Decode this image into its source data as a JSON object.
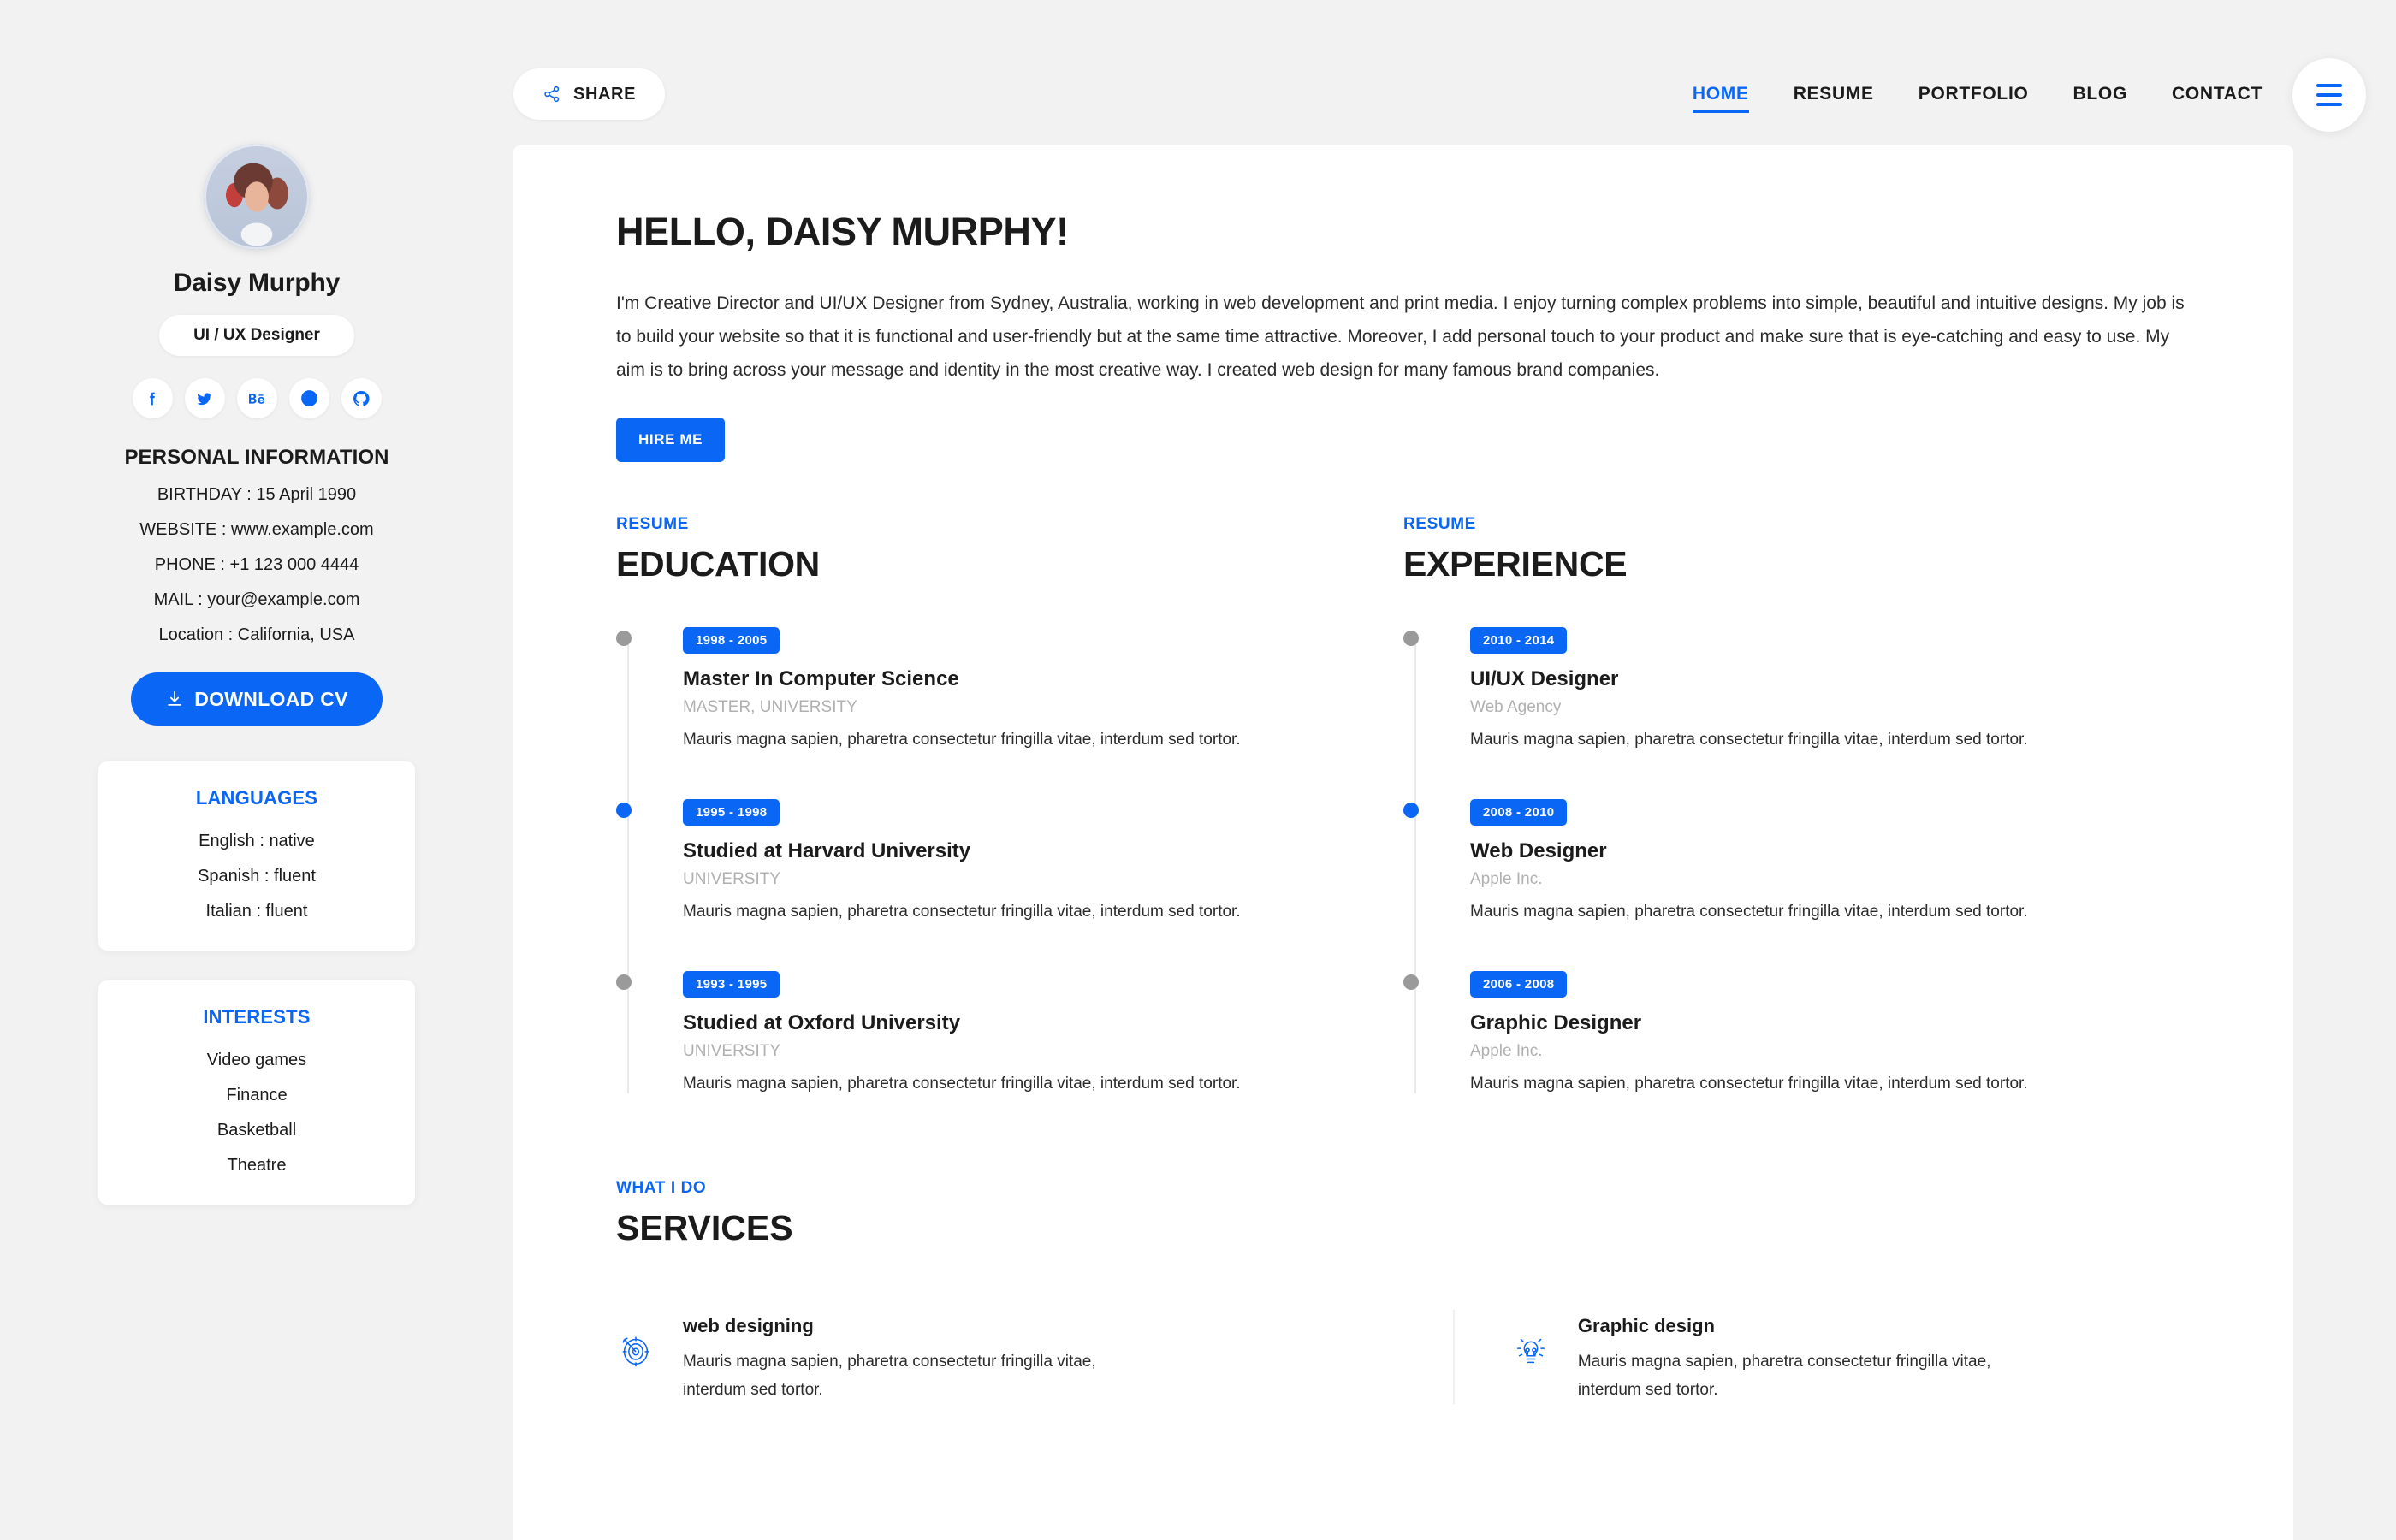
{
  "colors": {
    "accent": "#0a66f5",
    "page_bg": "#f2f2f2",
    "card_bg": "#ffffff",
    "muted": "#b0b0b0",
    "dot_gray": "#9a9a9a"
  },
  "sidebar": {
    "name": "Daisy Murphy",
    "role_pill": "UI / UX Designer",
    "social": [
      {
        "icon": "facebook-icon",
        "label": "Facebook"
      },
      {
        "icon": "twitter-icon",
        "label": "Twitter"
      },
      {
        "icon": "behance-icon",
        "label": "Behance"
      },
      {
        "icon": "dribbble-icon",
        "label": "Dribbble"
      },
      {
        "icon": "github-icon",
        "label": "GitHub"
      }
    ],
    "personal_title": "PERSONAL INFORMATION",
    "info": [
      "BIRTHDAY : 15 April 1990",
      "WEBSITE : www.example.com",
      "PHONE : +1 123 000 4444",
      "MAIL : your@example.com",
      "Location : California, USA"
    ],
    "download_label": "DOWNLOAD CV",
    "download_icon": "download-icon",
    "languages": {
      "title": "LANGUAGES",
      "rows": [
        "English : native",
        "Spanish : fluent",
        "Italian : fluent"
      ]
    },
    "interests": {
      "title": "INTERESTS",
      "rows": [
        "Video games",
        "Finance",
        "Basketball",
        "Theatre"
      ]
    }
  },
  "topbar": {
    "share_label": "SHARE",
    "share_icon": "share-network-icon",
    "menu_icon": "hamburger-menu-icon",
    "nav": [
      {
        "label": "HOME",
        "active": true
      },
      {
        "label": "RESUME",
        "active": false
      },
      {
        "label": "PORTFOLIO",
        "active": false
      },
      {
        "label": "BLOG",
        "active": false
      },
      {
        "label": "CONTACT",
        "active": false
      }
    ]
  },
  "hero": {
    "title": "HELLO, DAISY MURPHY!",
    "text": "I'm Creative Director and UI/UX Designer from Sydney, Australia, working in web development and print media. I enjoy turning complex problems into simple, beautiful and intuitive designs. My job is to build your website so that it is functional and user-friendly but at the same time attractive. Moreover, I add personal touch to your product and make sure that is eye-catching and easy to use. My aim is to bring across your message and identity in the most creative way. I created web design for many famous brand companies.",
    "cta_label": "HIRE ME"
  },
  "education": {
    "eyebrow": "RESUME",
    "title": "EDUCATION",
    "items": [
      {
        "period": "1998 - 2005",
        "role": "Master In Computer Science",
        "sub": "MASTER, UNIVERSITY",
        "desc": "Mauris magna sapien, pharetra consectetur fringilla vitae, interdum sed tortor.",
        "dot": "gray"
      },
      {
        "period": "1995 - 1998",
        "role": "Studied at Harvard University",
        "sub": "UNIVERSITY",
        "desc": "Mauris magna sapien, pharetra consectetur fringilla vitae, interdum sed tortor.",
        "dot": "accent"
      },
      {
        "period": "1993 - 1995",
        "role": "Studied at Oxford University",
        "sub": "UNIVERSITY",
        "desc": "Mauris magna sapien, pharetra consectetur fringilla vitae, interdum sed tortor.",
        "dot": "gray"
      }
    ]
  },
  "experience": {
    "eyebrow": "RESUME",
    "title": "EXPERIENCE",
    "items": [
      {
        "period": "2010 - 2014",
        "role": "UI/UX Designer",
        "sub": "Web Agency",
        "desc": "Mauris magna sapien, pharetra consectetur fringilla vitae, interdum sed tortor.",
        "dot": "gray"
      },
      {
        "period": "2008 - 2010",
        "role": "Web Designer",
        "sub": "Apple Inc.",
        "desc": "Mauris magna sapien, pharetra consectetur fringilla vitae, interdum sed tortor.",
        "dot": "accent"
      },
      {
        "period": "2006 - 2008",
        "role": "Graphic Designer",
        "sub": "Apple Inc.",
        "desc": "Mauris magna sapien, pharetra consectetur fringilla vitae, interdum sed tortor.",
        "dot": "gray"
      }
    ]
  },
  "services": {
    "eyebrow": "WHAT I DO",
    "title": "SERVICES",
    "items": [
      {
        "icon": "target-arrow-icon",
        "title": "web designing",
        "desc": "Mauris magna sapien, pharetra consectetur fringilla vitae, interdum sed tortor."
      },
      {
        "icon": "lightbulb-icon",
        "title": "Graphic design",
        "desc": "Mauris magna sapien, pharetra consectetur fringilla vitae, interdum sed tortor."
      }
    ]
  }
}
